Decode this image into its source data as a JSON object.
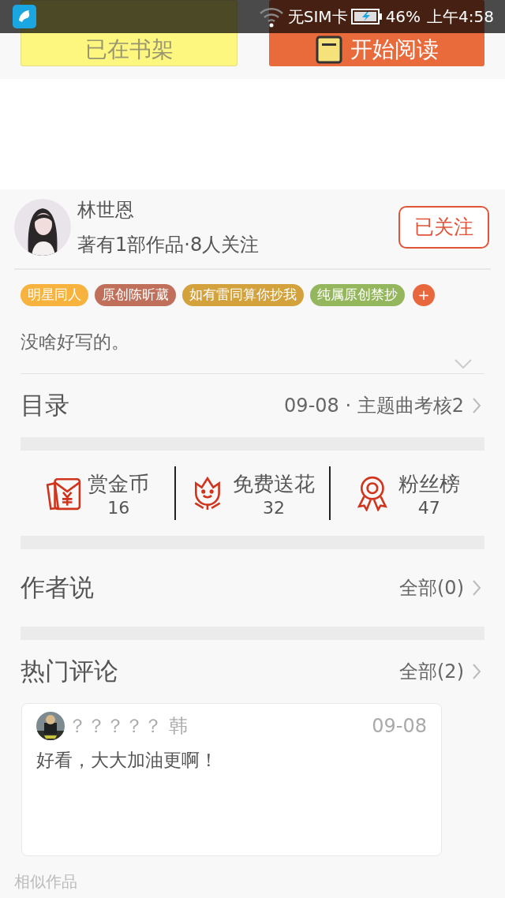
{
  "status_bar": {
    "carrier": "无SIM卡",
    "battery": "46%",
    "time": "上午4:58"
  },
  "action_buttons": [
    {
      "kind": "shelf",
      "label": "已在书架"
    },
    {
      "kind": "read",
      "label": "开始阅读"
    }
  ],
  "author": {
    "name": "林世恩",
    "stats": "著有1部作品·8人关注",
    "follow_button": "已关注"
  },
  "tags": [
    {
      "label": "明星同人",
      "color": "#f7b33d"
    },
    {
      "label": "原创陈昕葳",
      "color": "#c0705a"
    },
    {
      "label": "如有雷同算你抄我",
      "color": "#d3a23c"
    },
    {
      "label": "纯属原创禁抄",
      "color": "#94b65c"
    }
  ],
  "add_tag": "+",
  "intro": "没啥好写的。",
  "catalog": {
    "title": "目录",
    "latest": "09-08 · 主题曲考核2"
  },
  "stats": [
    {
      "kind": "coin",
      "label": "赏金币",
      "count": "16"
    },
    {
      "kind": "flower",
      "label": "免费送花",
      "count": "32"
    },
    {
      "kind": "fans",
      "label": "粉丝榜",
      "count": "47"
    }
  ],
  "author_notes": {
    "title": "作者说",
    "link": "全部(0)"
  },
  "comments": {
    "title": "热门评论",
    "link": "全部(2)",
    "items": [
      {
        "user": "？？？？？ 韩",
        "date": "09-08",
        "text": "好看，大大加油更啊！"
      }
    ]
  },
  "similar": {
    "title": "相似作品"
  }
}
